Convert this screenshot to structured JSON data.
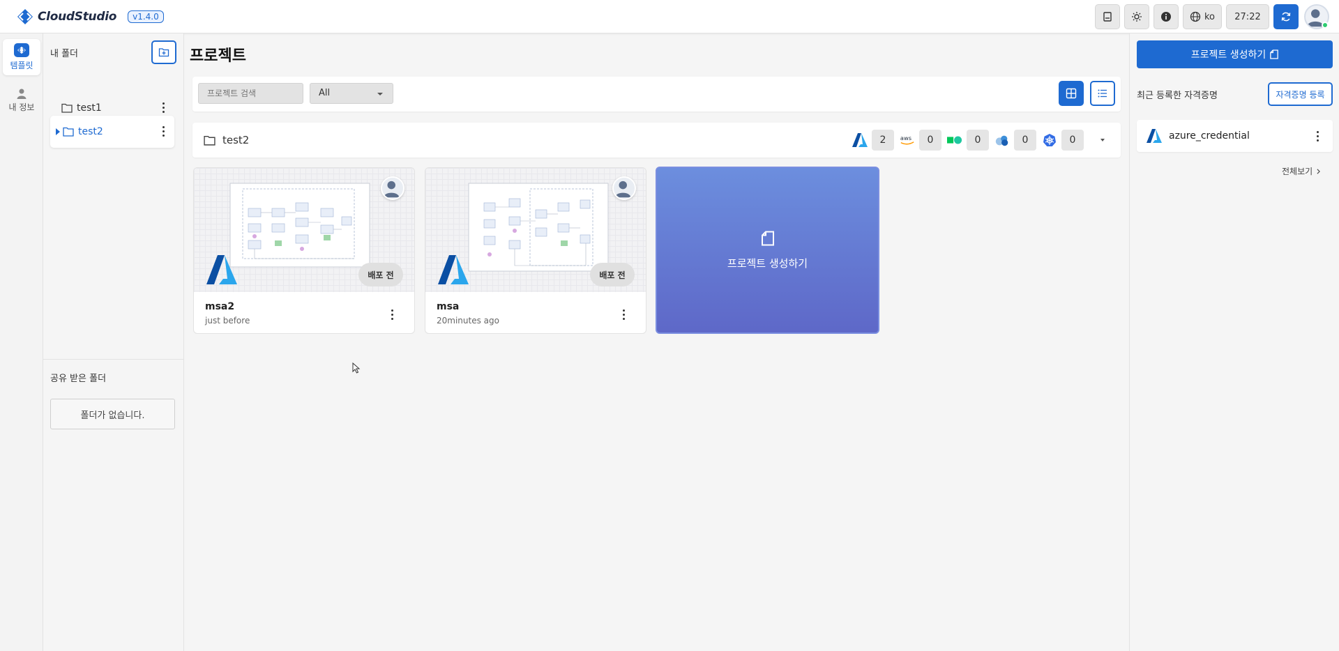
{
  "app": {
    "name": "CloudStudio",
    "version": "v1.4.0"
  },
  "topbar": {
    "docs_icon": "document-icon",
    "theme_icon": "sun-icon",
    "info_icon": "info-icon",
    "language": "ko",
    "session_timer": "27:22",
    "refresh_icon": "refresh-icon"
  },
  "rail": {
    "items": [
      {
        "label": "템플릿",
        "icon": "template-icon",
        "active": true
      },
      {
        "label": "내 정보",
        "icon": "person-icon",
        "active": false
      }
    ]
  },
  "folders": {
    "title": "내 폴더",
    "items": [
      {
        "name": "test1",
        "selected": false
      },
      {
        "name": "test2",
        "selected": true
      }
    ],
    "shared_title": "공유 받은 폴더",
    "shared_empty": "폴더가 없습니다."
  },
  "main": {
    "title": "프로젝트",
    "search_placeholder": "프로젝트 검색",
    "filter_value": "All",
    "current_folder": "test2",
    "providers": [
      {
        "icon": "azure-icon",
        "count": "2"
      },
      {
        "icon": "aws-icon",
        "count": "0"
      },
      {
        "icon": "ncp-icon",
        "count": "0"
      },
      {
        "icon": "nhn-icon",
        "count": "0"
      },
      {
        "icon": "kubernetes-icon",
        "count": "0"
      }
    ],
    "projects": [
      {
        "name": "msa2",
        "time": "just before",
        "status": "배포 전",
        "provider": "azure-icon"
      },
      {
        "name": "msa",
        "time": "20minutes ago",
        "status": "배포 전",
        "provider": "azure-icon"
      }
    ],
    "create_card_label": "프로젝트 생성하기"
  },
  "right": {
    "create_button": "프로젝트 생성하기",
    "cred_title": "최근 등록한 자격증명",
    "cred_register_button": "자격증명 등록",
    "credentials": [
      {
        "name": "azure_credential",
        "provider": "azure-icon"
      }
    ],
    "view_all": "전체보기"
  },
  "colors": {
    "accent": "#1e6ad1",
    "create_card": "#6478d4",
    "online": "#2ecc71"
  }
}
